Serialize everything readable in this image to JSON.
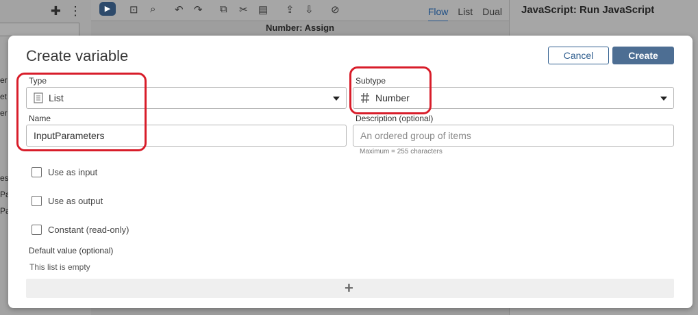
{
  "background": {
    "left_fragments": [
      "er",
      "et",
      "er",
      "es",
      "Pa",
      "Pa"
    ],
    "toolbar_tabs": [
      "Flow",
      "List",
      "Dual"
    ],
    "canvas_node_title": "Number: Assign",
    "right_panel_title": "JavaScript: Run JavaScript"
  },
  "modal": {
    "title": "Create variable",
    "cancel_label": "Cancel",
    "create_label": "Create",
    "type": {
      "label": "Type",
      "value": "List",
      "icon": "list-icon"
    },
    "subtype": {
      "label": "Subtype",
      "value": "Number",
      "icon": "hash-icon"
    },
    "name": {
      "label": "Name",
      "value": "InputParameters"
    },
    "description": {
      "label": "Description (optional)",
      "placeholder": "An ordered group of items",
      "hint": "Maximum = 255 characters"
    },
    "checkboxes": [
      {
        "label": "Use as input",
        "checked": false
      },
      {
        "label": "Use as output",
        "checked": false
      },
      {
        "label": "Constant (read-only)",
        "checked": false
      }
    ],
    "default_value": {
      "label": "Default value (optional)",
      "empty_text": "This list is empty"
    }
  },
  "colors": {
    "accent": "#2e5d8e",
    "create_button": "#4d6e93",
    "highlight": "#d81d2a"
  }
}
